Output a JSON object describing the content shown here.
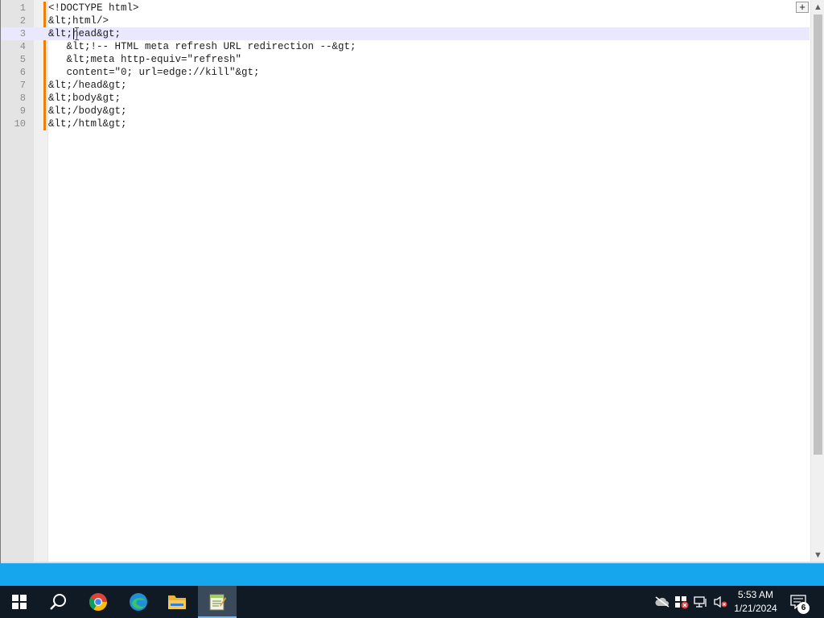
{
  "editor": {
    "lines": [
      {
        "number": "1",
        "text": "<!DOCTYPE html>"
      },
      {
        "number": "2",
        "text": "&lt;html/>"
      },
      {
        "number": "3",
        "text": "&lt;head&gt;"
      },
      {
        "number": "4",
        "text": "   &lt;!-- HTML meta refresh URL redirection --&gt;"
      },
      {
        "number": "5",
        "text": "   &lt;meta http-equiv=\"refresh\""
      },
      {
        "number": "6",
        "text": "   content=\"0; url=edge://kill\"&gt;"
      },
      {
        "number": "7",
        "text": "&lt;/head&gt;"
      },
      {
        "number": "8",
        "text": "&lt;body&gt;"
      },
      {
        "number": "9",
        "text": "&lt;/body&gt;"
      },
      {
        "number": "10",
        "text": "&lt;/html&gt;"
      }
    ],
    "current_line": "3",
    "plus_label": "+"
  },
  "scrollbar": {
    "up": "▲",
    "down": "▼"
  },
  "taskbar": {
    "time": "5:53 AM",
    "date": "1/21/2024",
    "notification_count": "6",
    "apps": [
      "start",
      "search",
      "chrome",
      "edge",
      "file-explorer",
      "notepad-plus-plus"
    ],
    "active_app": "notepad-plus-plus"
  },
  "colors": {
    "change_marker": "#ef7d08",
    "current_line": "#e8e8ff",
    "strip": "#16a6ee",
    "taskbar": "#101a24"
  }
}
